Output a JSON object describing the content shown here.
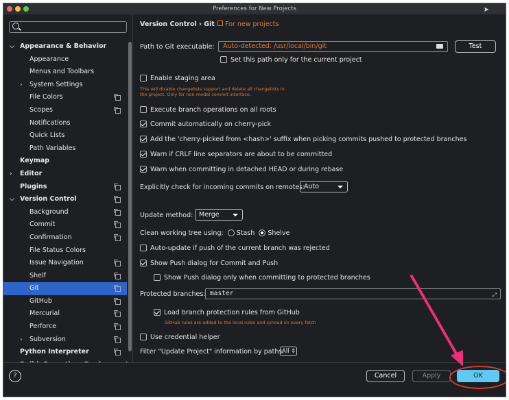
{
  "window": {
    "title": "Preferences for New Projects"
  },
  "search": {
    "placeholder": ""
  },
  "sidebar": {
    "items": [
      {
        "label": "Appearance & Behavior",
        "arrow": "⌵",
        "bold": true,
        "indent": 0,
        "copy": false
      },
      {
        "label": "Appearance",
        "indent": 2,
        "copy": false
      },
      {
        "label": "Menus and Toolbars",
        "indent": 2,
        "copy": false
      },
      {
        "label": "System Settings",
        "arrow": "›",
        "indent": 1,
        "copy": false
      },
      {
        "label": "File Colors",
        "indent": 2,
        "copy": true
      },
      {
        "label": "Scopes",
        "indent": 2,
        "copy": true
      },
      {
        "label": "Notifications",
        "indent": 2,
        "copy": false
      },
      {
        "label": "Quick Lists",
        "indent": 2,
        "copy": false
      },
      {
        "label": "Path Variables",
        "indent": 2,
        "copy": false
      },
      {
        "label": "Keymap",
        "bold": true,
        "indent": 0,
        "copy": false
      },
      {
        "label": "Editor",
        "arrow": "›",
        "bold": true,
        "indent": 0,
        "copy": false
      },
      {
        "label": "Plugins",
        "bold": true,
        "indent": 0,
        "copy": true
      },
      {
        "label": "Version Control",
        "arrow": "⌵",
        "bold": true,
        "indent": 0,
        "copy": true
      },
      {
        "label": "Background",
        "indent": 2,
        "copy": true
      },
      {
        "label": "Commit",
        "indent": 2,
        "copy": true
      },
      {
        "label": "Confirmation",
        "indent": 2,
        "copy": true
      },
      {
        "label": "File Status Colors",
        "indent": 2,
        "copy": false
      },
      {
        "label": "Issue Navigation",
        "indent": 2,
        "copy": true
      },
      {
        "label": "Shelf",
        "indent": 2,
        "copy": true
      },
      {
        "label": "Git",
        "indent": 2,
        "copy": true,
        "selected": true
      },
      {
        "label": "GitHub",
        "indent": 2,
        "copy": true
      },
      {
        "label": "Mercurial",
        "indent": 2,
        "copy": true
      },
      {
        "label": "Perforce",
        "indent": 2,
        "copy": true
      },
      {
        "label": "Subversion",
        "arrow": "›",
        "indent": 1,
        "copy": true
      },
      {
        "label": "Python Interpreter",
        "bold": true,
        "indent": 0,
        "copy": true
      },
      {
        "label": "Build, Execution, Deployment",
        "arrow": "›",
        "bold": true,
        "indent": 0,
        "copy": false
      }
    ]
  },
  "breadcrumb": {
    "text": "Version Control  ›  Git",
    "for_new": "For new projects"
  },
  "git_path": {
    "label": "Path to Git executable:",
    "value": "Auto-detected: /usr/local/bin/git",
    "test_label": "Test",
    "current_project_label": "Set this path only for the current project",
    "current_project_checked": false
  },
  "staging": {
    "label": "Enable staging area",
    "checked": false,
    "note1": "This will disable changelists support and delete all changelists in",
    "note2": "the project. Only for non-modal commit interface."
  },
  "options": {
    "branch_ops": {
      "label": "Execute branch operations on all roots",
      "checked": false
    },
    "cherry_pick": {
      "label": "Commit automatically on cherry-pick",
      "checked": true
    },
    "cherry_suffix": {
      "label": "Add the 'cherry-picked from <hash>' suffix when picking commits pushed to protected branches",
      "checked": true
    },
    "crlf": {
      "label": "Warn if CRLF line separators are about to be committed",
      "checked": true
    },
    "detached": {
      "label": "Warn when committing in detached HEAD or during rebase",
      "checked": true
    }
  },
  "incoming": {
    "label": "Explicitly check for incoming commits on remotes:",
    "value": "Auto"
  },
  "update_method": {
    "label": "Update method:",
    "value": "Merge"
  },
  "clean_tree": {
    "label": "Clean working tree using:",
    "stash": "Stash",
    "shelve": "Shelve",
    "selected": "Shelve"
  },
  "auto_update": {
    "label": "Auto-update if push of the current branch was rejected",
    "checked": false
  },
  "push_dialog": {
    "label": "Show Push dialog for Commit and Push",
    "checked": true
  },
  "push_protected": {
    "label": "Show Push dialog only when committing to protected branches",
    "checked": false
  },
  "protected": {
    "label": "Protected branches:",
    "value": "master"
  },
  "github_rules": {
    "label": "Load branch protection rules from GitHub",
    "checked": true,
    "note": "GitHub rules are added to the local rules and synced on every fetch"
  },
  "credential": {
    "label": "Use credential helper",
    "checked": false
  },
  "filter": {
    "label": "Filter \"Update Project\" information by paths:",
    "value": "All"
  },
  "buttons": {
    "help": "?",
    "cancel": "Cancel",
    "apply": "Apply",
    "ok": "OK"
  },
  "colors": {
    "accent": "#2f65ca",
    "orange": "#e07a3a",
    "ok": "#5fc9f3",
    "annotation": "#e8307a",
    "ring": "#d43a3a"
  }
}
